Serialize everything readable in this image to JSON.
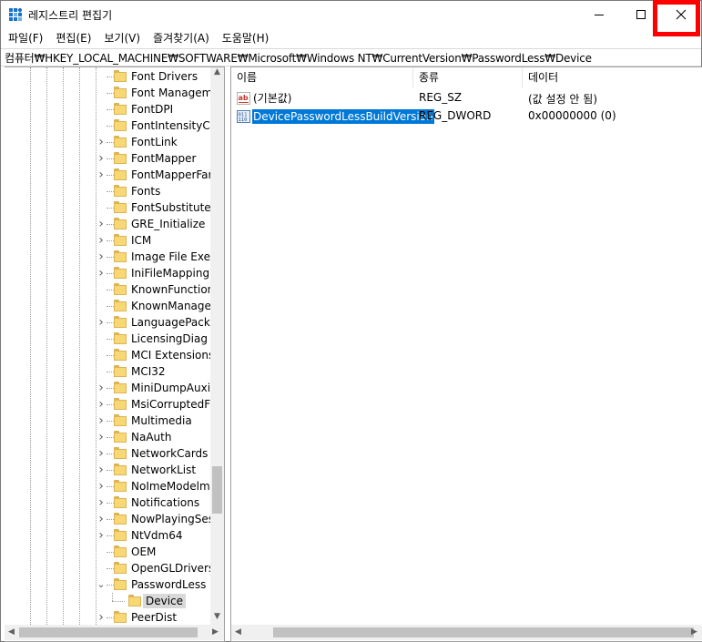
{
  "window": {
    "title": "레지스트리 편집기"
  },
  "titlebar": {
    "minimize_icon": "minimize-icon",
    "maximize_icon": "maximize-icon",
    "close_icon": "close-icon",
    "close_highlight_color": "#ff0000"
  },
  "menu": {
    "items": [
      "파일(F)",
      "편집(E)",
      "보기(V)",
      "즐겨찾기(A)",
      "도움말(H)"
    ]
  },
  "address": {
    "path": "컴퓨터₩HKEY_LOCAL_MACHINE₩SOFTWARE₩Microsoft₩Windows NT₩CurrentVersion₩PasswordLess₩Device"
  },
  "tree": {
    "items": [
      {
        "label": "Font Drivers",
        "expander": ""
      },
      {
        "label": "Font Managemen",
        "expander": ""
      },
      {
        "label": "FontDPI",
        "expander": ""
      },
      {
        "label": "FontIntensityCorr",
        "expander": ""
      },
      {
        "label": "FontLink",
        "expander": "›"
      },
      {
        "label": "FontMapper",
        "expander": "›"
      },
      {
        "label": "FontMapperFamil",
        "expander": "›"
      },
      {
        "label": "Fonts",
        "expander": ""
      },
      {
        "label": "FontSubstitutes",
        "expander": ""
      },
      {
        "label": "GRE_Initialize",
        "expander": "›"
      },
      {
        "label": "ICM",
        "expander": "›"
      },
      {
        "label": "Image File Execu",
        "expander": "›"
      },
      {
        "label": "IniFileMapping",
        "expander": "›"
      },
      {
        "label": "KnownFunctionTa",
        "expander": ""
      },
      {
        "label": "KnownManagedD",
        "expander": ""
      },
      {
        "label": "LanguagePack",
        "expander": "›"
      },
      {
        "label": "LicensingDiag",
        "expander": ""
      },
      {
        "label": "MCI Extensions",
        "expander": ""
      },
      {
        "label": "MCI32",
        "expander": ""
      },
      {
        "label": "MiniDumpAuxilia",
        "expander": "›"
      },
      {
        "label": "MsiCorruptedFile",
        "expander": "›"
      },
      {
        "label": "Multimedia",
        "expander": "›"
      },
      {
        "label": "NaAuth",
        "expander": "›"
      },
      {
        "label": "NetworkCards",
        "expander": "›"
      },
      {
        "label": "NetworkList",
        "expander": "›"
      },
      {
        "label": "NoImeModelmes",
        "expander": "›"
      },
      {
        "label": "Notifications",
        "expander": "›"
      },
      {
        "label": "NowPlayingSessi",
        "expander": "›"
      },
      {
        "label": "NtVdm64",
        "expander": "›"
      },
      {
        "label": "OEM",
        "expander": ""
      },
      {
        "label": "OpenGLDrivers",
        "expander": ""
      },
      {
        "label": "PasswordLess",
        "expander": "⌄"
      },
      {
        "label": "Device",
        "expander": "",
        "child": true,
        "selected": true
      },
      {
        "label": "PeerDist",
        "expander": "›"
      }
    ]
  },
  "list": {
    "columns": [
      "이름",
      "종류",
      "데이터"
    ],
    "rows": [
      {
        "icon": "string-value-icon",
        "name": "(기본값)",
        "type": "REG_SZ",
        "data": "(값 설정 안 됨)",
        "selected": false
      },
      {
        "icon": "binary-value-icon",
        "name": "DevicePasswordLessBuildVersion",
        "type": "REG_DWORD",
        "data": "0x00000000 (0)",
        "selected": true
      }
    ]
  },
  "colors": {
    "selection_blue": "#0078d7",
    "folder_yellow": "#f8d775",
    "tree_selection_gray": "#d9d9d9"
  }
}
